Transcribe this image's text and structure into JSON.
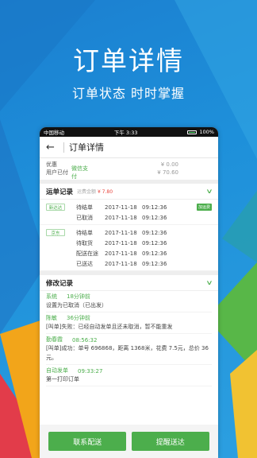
{
  "promo": {
    "headline": "订单详情",
    "subline": "订单状态  时时掌握"
  },
  "statusbar": {
    "carrier": "中国移动",
    "time": "下午 3:33",
    "battery": "100%"
  },
  "nav": {
    "back_icon": "arrow-left-icon",
    "title": "订单详情"
  },
  "payment": {
    "rows": [
      {
        "label": "优惠",
        "method": "",
        "amount": "¥ 0.00"
      },
      {
        "label": "用户已付",
        "method": "微信支付",
        "amount": "¥ 70.60"
      }
    ]
  },
  "shipping": {
    "title": "运单记录",
    "fee_label": "运费金额",
    "fee_value": "¥ 7.80",
    "carriers": [
      {
        "tag": "新达达",
        "entries": [
          {
            "status": "待结单",
            "date": "2017-11-18",
            "time": "09:12:36",
            "badge": "加运费"
          },
          {
            "status": "已取消",
            "date": "2017-11-18",
            "time": "09:12:36",
            "badge": ""
          }
        ]
      },
      {
        "tag": "京东",
        "entries": [
          {
            "status": "待结单",
            "date": "2017-11-18",
            "time": "09:12:36",
            "badge": ""
          },
          {
            "status": "待取货",
            "date": "2017-11-18",
            "time": "09:12:36",
            "badge": ""
          },
          {
            "status": "配送在途",
            "date": "2017-11-18",
            "time": "09:12:36",
            "badge": ""
          },
          {
            "status": "已送达",
            "date": "2017-11-18",
            "time": "09:12:36",
            "badge": ""
          }
        ]
      }
    ]
  },
  "changes": {
    "title": "修改记录",
    "entries": [
      {
        "who": "系统",
        "when": "18分钟前",
        "msg": "设置为已取消（已出发）"
      },
      {
        "who": "陈敏",
        "when": "36分钟前",
        "msg": "[叫单]失败：已经自动发单且还未取消，暂不能重发"
      },
      {
        "who": "勤春霞",
        "when": "08:56:32",
        "msg": "[叫单]成功：单号 696868，距离 1368米，花费 7.5元，总价 36元。"
      },
      {
        "who": "自动发单",
        "when": "09:33:27",
        "msg": "第一打印订单"
      }
    ]
  },
  "actions": {
    "contact": "联系配送",
    "remind": "提醒送达"
  },
  "colors": {
    "accent": "#4cae4c",
    "fee": "#e8433a",
    "background": "#1f8fd6"
  }
}
